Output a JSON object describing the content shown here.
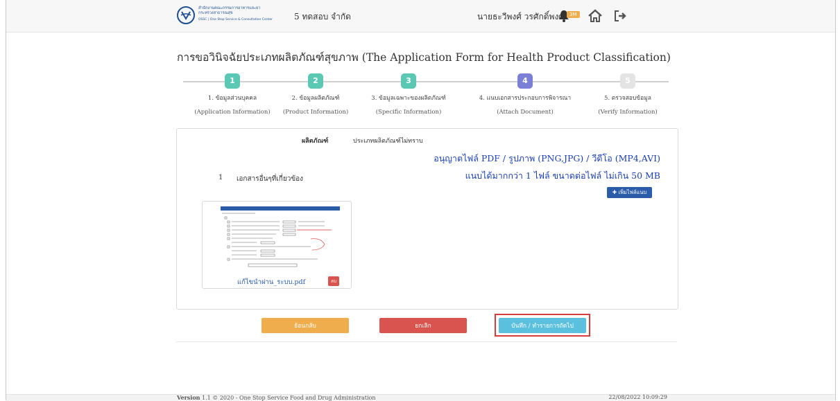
{
  "header": {
    "logo_text_line1": "สำนักงานคณะกรรมการอาหารและยา",
    "logo_text_line2": "กระทรวงสาธารณสุข",
    "logo_text_line3": "OSSC | One Stop Service & Consultation Center",
    "company": "5 ทดสอบ จำกัด",
    "username": "นายธะวีพงศ์ วรศักดิ์พงศ์",
    "notification_count": "3M",
    "icons": [
      "bell-icon",
      "home-icon",
      "logout-icon"
    ]
  },
  "page": {
    "title": "การขอวินิจฉัยประเภทผลิตภัณฑ์สุขภาพ (The Application Form for Health Product Classification)"
  },
  "stepper": {
    "steps": [
      {
        "number": "1",
        "label": "1. ข้อมูลส่วนบุคคล",
        "sub": "(Application Information)",
        "status": "done",
        "color": "#5bc8b4"
      },
      {
        "number": "2",
        "label": "2. ข้อมูลผลิตภัณฑ์",
        "sub": "(Product Information)",
        "status": "done",
        "color": "#5bc8b4"
      },
      {
        "number": "3",
        "label": "3. ข้อมูลเฉพาะของผลิตภัณฑ์",
        "sub": "(Specific Information)",
        "status": "done",
        "color": "#5bc8b4"
      },
      {
        "number": "4",
        "label": "4. แนบเอกสารประกอบการพิจารณา",
        "sub": "(Attach Document)",
        "status": "active",
        "color": "#7b7fd6"
      },
      {
        "number": "5",
        "label": "5. ตรวจสอบข้อมูล",
        "sub": "(Verify Information)",
        "status": "pending",
        "color": "#e4e4e4"
      }
    ]
  },
  "card": {
    "product_label": "ผลิตภัณฑ์",
    "product_value": "ประเภทผลิตภัณฑ์ไม่ทราบ",
    "allowed_types": "อนุญาตไฟล์ PDF / รูปภาพ (PNG,JPG) / วีดีโอ (MP4,AVI)",
    "allowed_size": "แนบได้มากกว่า 1 ไฟล์ ขนาดต่อไฟล์ ไม่เกิน 50 MB",
    "document_number": "1",
    "document_label": "เอกสารอื่นๆที่เกี่ยวข้อง",
    "attach_button": "✚ เพิ่มไฟล์แนบ",
    "file_name": "แก้ไขนำผ่าน_ระบบ.pdf",
    "delete_button": "ลบ"
  },
  "actions": {
    "back": "ย้อนกลับ",
    "cancel": "ยกเลิก",
    "save": "บันทึก / ทำรายการถัดไป"
  },
  "footer": {
    "version_label": "Version",
    "version_text": " 1.1 © 2020 - One Stop Service Food and Drug Administration",
    "datetime": "22/08/2022 10:09:29"
  },
  "colors": {
    "step_done": "#5bc8b4",
    "step_active": "#7b7fd6",
    "step_pending": "#e4e4e4",
    "link_blue": "#1a3fb5",
    "btn_back": "#f0ad4e",
    "btn_cancel": "#d9534f",
    "btn_save": "#5bc0de",
    "highlight_border": "#d93b3b"
  }
}
